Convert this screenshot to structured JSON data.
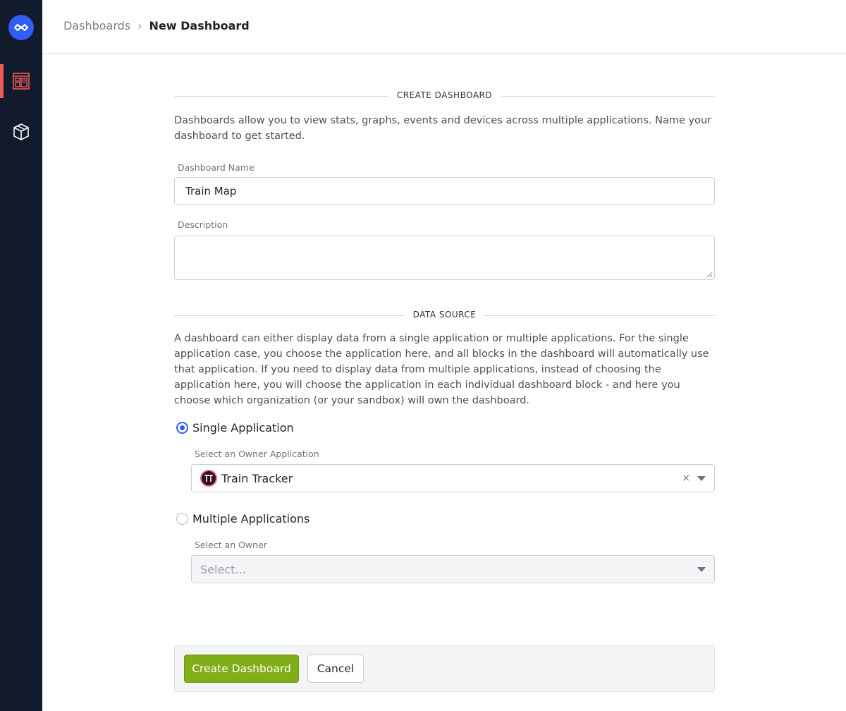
{
  "breadcrumb": {
    "parent": "Dashboards",
    "separator": "›",
    "current": "New Dashboard"
  },
  "sidebar": {
    "items": [
      {
        "icon": "dashboard-icon",
        "active": true
      },
      {
        "icon": "box-icon",
        "active": false
      }
    ]
  },
  "create_section": {
    "title": "CREATE DASHBOARD",
    "description": "Dashboards allow you to view stats, graphs, events and devices across multiple applications. Name your dashboard to get started.",
    "name_label": "Dashboard Name",
    "name_value": "Train Map",
    "description_label": "Description",
    "description_value": ""
  },
  "data_source": {
    "title": "DATA SOURCE",
    "description": "A dashboard can either display data from a single application or multiple applications. For the single application case, you choose the application here, and all blocks in the dashboard will automatically use that application. If you need to display data from multiple applications, instead of choosing the application here, you will choose the application in each individual dashboard block - and here you choose which organization (or your sandbox) will own the dashboard.",
    "single": {
      "label": "Single Application",
      "selected": true,
      "select_label": "Select an Owner Application",
      "value": "Train Tracker",
      "clear": "×"
    },
    "multiple": {
      "label": "Multiple Applications",
      "selected": false,
      "select_label": "Select an Owner",
      "placeholder": "Select..."
    }
  },
  "actions": {
    "create_label": "Create Dashboard",
    "cancel_label": "Cancel"
  },
  "colors": {
    "sidebar": "#121b2b",
    "accent": "#2f5df5",
    "primary_button": "#81ad18",
    "active_nav": "#f05a5a"
  }
}
